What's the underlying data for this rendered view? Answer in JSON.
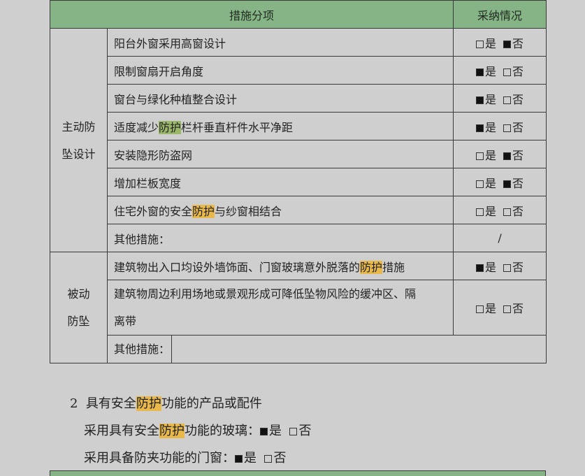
{
  "table": {
    "header_measure": "措施分项",
    "header_status": "采纳情况",
    "yes": "是",
    "no": "否",
    "active_group": "主动防坠设计",
    "active_group_line1": "主动防",
    "active_group_line2": "坠设计",
    "active_rows": [
      {
        "pre": "阳台外窗采用高窗设计",
        "hl": "",
        "post": "",
        "yes": false,
        "no": true
      },
      {
        "pre": "限制窗扇开启角度",
        "hl": "",
        "post": "",
        "yes": true,
        "no": false
      },
      {
        "pre": "窗台与绿化种植整合设计",
        "hl": "",
        "post": "",
        "yes": true,
        "no": false
      },
      {
        "pre": "适度减少",
        "hl": "防护",
        "post": "栏杆垂直杆件水平净距",
        "yes": true,
        "no": false
      },
      {
        "pre": "安装隐形防盗网",
        "hl": "",
        "post": "",
        "yes": false,
        "no": true
      },
      {
        "pre": "增加栏板宽度",
        "hl": "",
        "post": "",
        "yes": false,
        "no": true
      },
      {
        "pre": "住宅外窗的安全",
        "hl": "防护",
        "post": "与纱窗相结合",
        "yes": false,
        "no": false
      }
    ],
    "active_other": "其他措施：",
    "active_other_value": "/",
    "passive_group_line1": "被动",
    "passive_group_line2": "防坠",
    "passive_row1": {
      "pre": "建筑物出入口均设外墙饰面、门窗玻璃意外脱落的",
      "hl": "防护",
      "post": "措施"
    },
    "passive_row2_line1": "建筑物周边利用场地或景观形成可降低坠物风险的缓冲区、隔",
    "passive_row2_line2": "离带",
    "passive_other": "其他措施："
  },
  "section2": {
    "number": "2",
    "title_pre": "具有安全",
    "title_hl": "防护",
    "title_post": "功能的产品或配件",
    "line1_pre": "采用具有安全",
    "line1_hl": "防护",
    "line1_post": "功能的玻璃：",
    "line2": "采用具备防夹功能的门窗："
  },
  "colors": {
    "header_green": "#86b486",
    "highlight": "#e8b84a",
    "background": "#cfcfcf"
  }
}
